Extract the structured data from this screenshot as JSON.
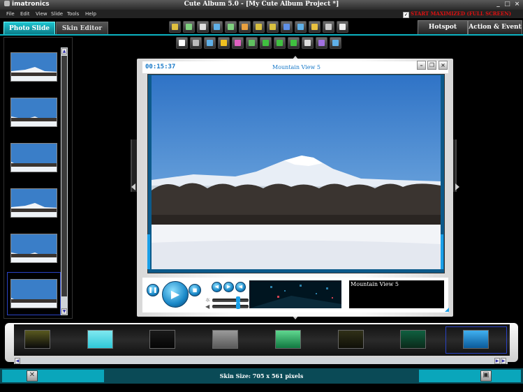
{
  "app": {
    "brand": "imatronics",
    "title": "Cute Album 5.0 - [My Cute Album Project *]",
    "window_controls": [
      "_",
      "□",
      "×"
    ]
  },
  "menu": {
    "items": [
      "File",
      "Edit",
      "View",
      "Slide",
      "Tools",
      "Help"
    ],
    "start_maximized": "START MAXIMIZED (FULL SCREEN)",
    "start_maximized_checked": true
  },
  "tabs": {
    "photo_slide": "Photo Slide",
    "skin_editor": "Skin Editor",
    "hotspot": "Hotspot",
    "action_event": "Action & Event"
  },
  "toolbar_top": [
    {
      "icon": "wand-icon",
      "color": "#e0c040"
    },
    {
      "icon": "add-image-icon",
      "color": "#7fd17f"
    },
    {
      "icon": "eye-icon",
      "color": "#dddddd"
    },
    {
      "icon": "export-icon",
      "color": "#5fb0e8"
    },
    {
      "icon": "resize-icon",
      "color": "#7fd17f"
    },
    {
      "icon": "grid-icon",
      "color": "#e8a040"
    },
    {
      "icon": "tag-icon",
      "color": "#d8c040"
    },
    {
      "icon": "tag-edit-icon",
      "color": "#d8c040"
    },
    {
      "icon": "save-icon",
      "color": "#5f90e8"
    },
    {
      "icon": "copy-icon",
      "color": "#5fb0e8"
    },
    {
      "icon": "folder-icon",
      "color": "#e8c040"
    },
    {
      "icon": "print-icon",
      "color": "#cccccc"
    },
    {
      "icon": "music-icon",
      "color": "#eeeeee"
    }
  ],
  "toolbar_second": [
    {
      "icon": "circle-white-icon",
      "color": "#ffffff"
    },
    {
      "icon": "contrast-icon",
      "color": "#bbbbbb"
    },
    {
      "icon": "frame-icon",
      "color": "#5fb0e8"
    },
    {
      "icon": "sun-icon",
      "color": "#f0c020"
    },
    {
      "icon": "color-wheel-icon",
      "color": "#e060c0"
    },
    {
      "icon": "levels-icon",
      "color": "#60c060"
    },
    {
      "icon": "rotate-left-icon",
      "color": "#40c040"
    },
    {
      "icon": "rotate-right-icon",
      "color": "#40c040"
    },
    {
      "icon": "refresh-icon",
      "color": "#40c040"
    },
    {
      "icon": "crop-icon",
      "color": "#dddddd"
    },
    {
      "icon": "layer-icon",
      "color": "#a070e0"
    },
    {
      "icon": "resize-photo-icon",
      "color": "#5fb0e8"
    }
  ],
  "stage": {
    "time": "00:15:37",
    "caption": "Mountain View 5",
    "text_panel": "Mountain View 5"
  },
  "status": {
    "skin_size": "Skin Size: 705 x 561 pixels"
  },
  "photos_count": 6,
  "selected_photo": 6,
  "selected_skin": 8,
  "skins": [
    {
      "top": "#5a5a20",
      "bottom": "#0a0a0a"
    },
    {
      "top": "#7fe8f0",
      "bottom": "#2ec8d8"
    },
    {
      "top": "#1a1a1a",
      "bottom": "#050505"
    },
    {
      "top": "#9a9a9a",
      "bottom": "#5a5a5a"
    },
    {
      "top": "#60d890",
      "bottom": "#107840"
    },
    {
      "top": "#303018",
      "bottom": "#101008"
    },
    {
      "top": "#106040",
      "bottom": "#0a2a1a"
    },
    {
      "top": "#40b0f0",
      "bottom": "#0a5a9a"
    }
  ]
}
